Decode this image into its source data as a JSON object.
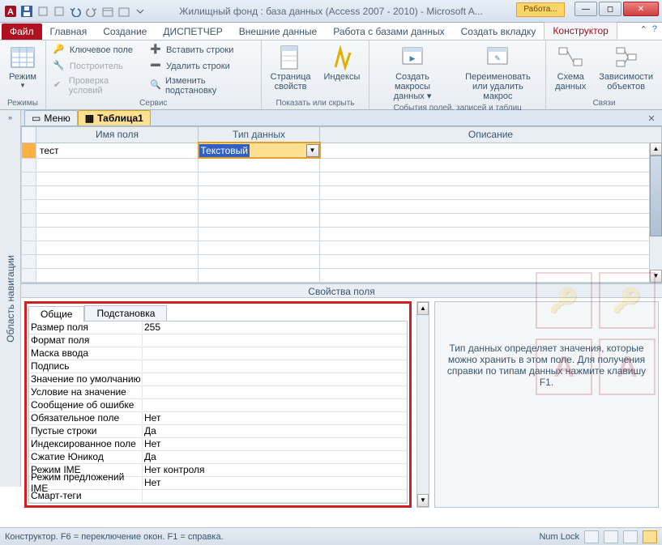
{
  "title": "Жилищный фонд : база данных (Access 2007 - 2010)  -  Microsoft A...",
  "work_tab": "Работа...",
  "file_tab": "Файл",
  "ribbon_tabs": [
    "Главная",
    "Создание",
    "ДИСПЕТЧЕР",
    "Внешние данные",
    "Работа с базами данных",
    "Создать вкладку",
    "Конструктор"
  ],
  "ribbon": {
    "g1": {
      "mode": "Режим",
      "label": "Режимы"
    },
    "g2": {
      "pk": "Ключевое поле",
      "builder": "Построитель",
      "test": "Проверка условий",
      "ins": "Вставить строки",
      "del": "Удалить строки",
      "lookup": "Изменить подстановку",
      "label": "Сервис"
    },
    "g3": {
      "props": "Страница\nсвойств",
      "idx": "Индексы",
      "label": "Показать или скрыть"
    },
    "g4": {
      "macro": "Создать макросы\nданных ▾",
      "rename": "Переименовать\nили удалить макрос",
      "label": "События полей, записей и таблиц"
    },
    "g5": {
      "schema": "Схема\nданных",
      "deps": "Зависимости\nобъектов",
      "label": "Связи"
    }
  },
  "nav_panel": "Область навигации",
  "tabs": {
    "menu": "Меню",
    "t1": "Таблица1"
  },
  "grid": {
    "h_name": "Имя поля",
    "h_type": "Тип данных",
    "h_desc": "Описание",
    "r1_name": "тест",
    "r1_type": "Текстовый"
  },
  "split": "Свойства поля",
  "prop_tabs": {
    "general": "Общие",
    "lookup": "Подстановка"
  },
  "props": [
    {
      "k": "Размер поля",
      "v": "255"
    },
    {
      "k": "Формат поля",
      "v": ""
    },
    {
      "k": "Маска ввода",
      "v": ""
    },
    {
      "k": "Подпись",
      "v": ""
    },
    {
      "k": "Значение по умолчанию",
      "v": ""
    },
    {
      "k": "Условие на значение",
      "v": ""
    },
    {
      "k": "Сообщение об ошибке",
      "v": ""
    },
    {
      "k": "Обязательное поле",
      "v": "Нет"
    },
    {
      "k": "Пустые строки",
      "v": "Да"
    },
    {
      "k": "Индексированное поле",
      "v": "Нет"
    },
    {
      "k": "Сжатие Юникод",
      "v": "Да"
    },
    {
      "k": "Режим IME",
      "v": "Нет контроля"
    },
    {
      "k": "Режим предложений IME",
      "v": "Нет"
    },
    {
      "k": "Смарт-теги",
      "v": ""
    }
  ],
  "hint": "Тип данных определяет значения, которые можно хранить в этом поле. Для получения справки по типам данных нажмите клавишу F1.",
  "status_left": "Конструктор.  F6 = переключение окон.  F1 = справка.",
  "status_num": "Num Lock"
}
